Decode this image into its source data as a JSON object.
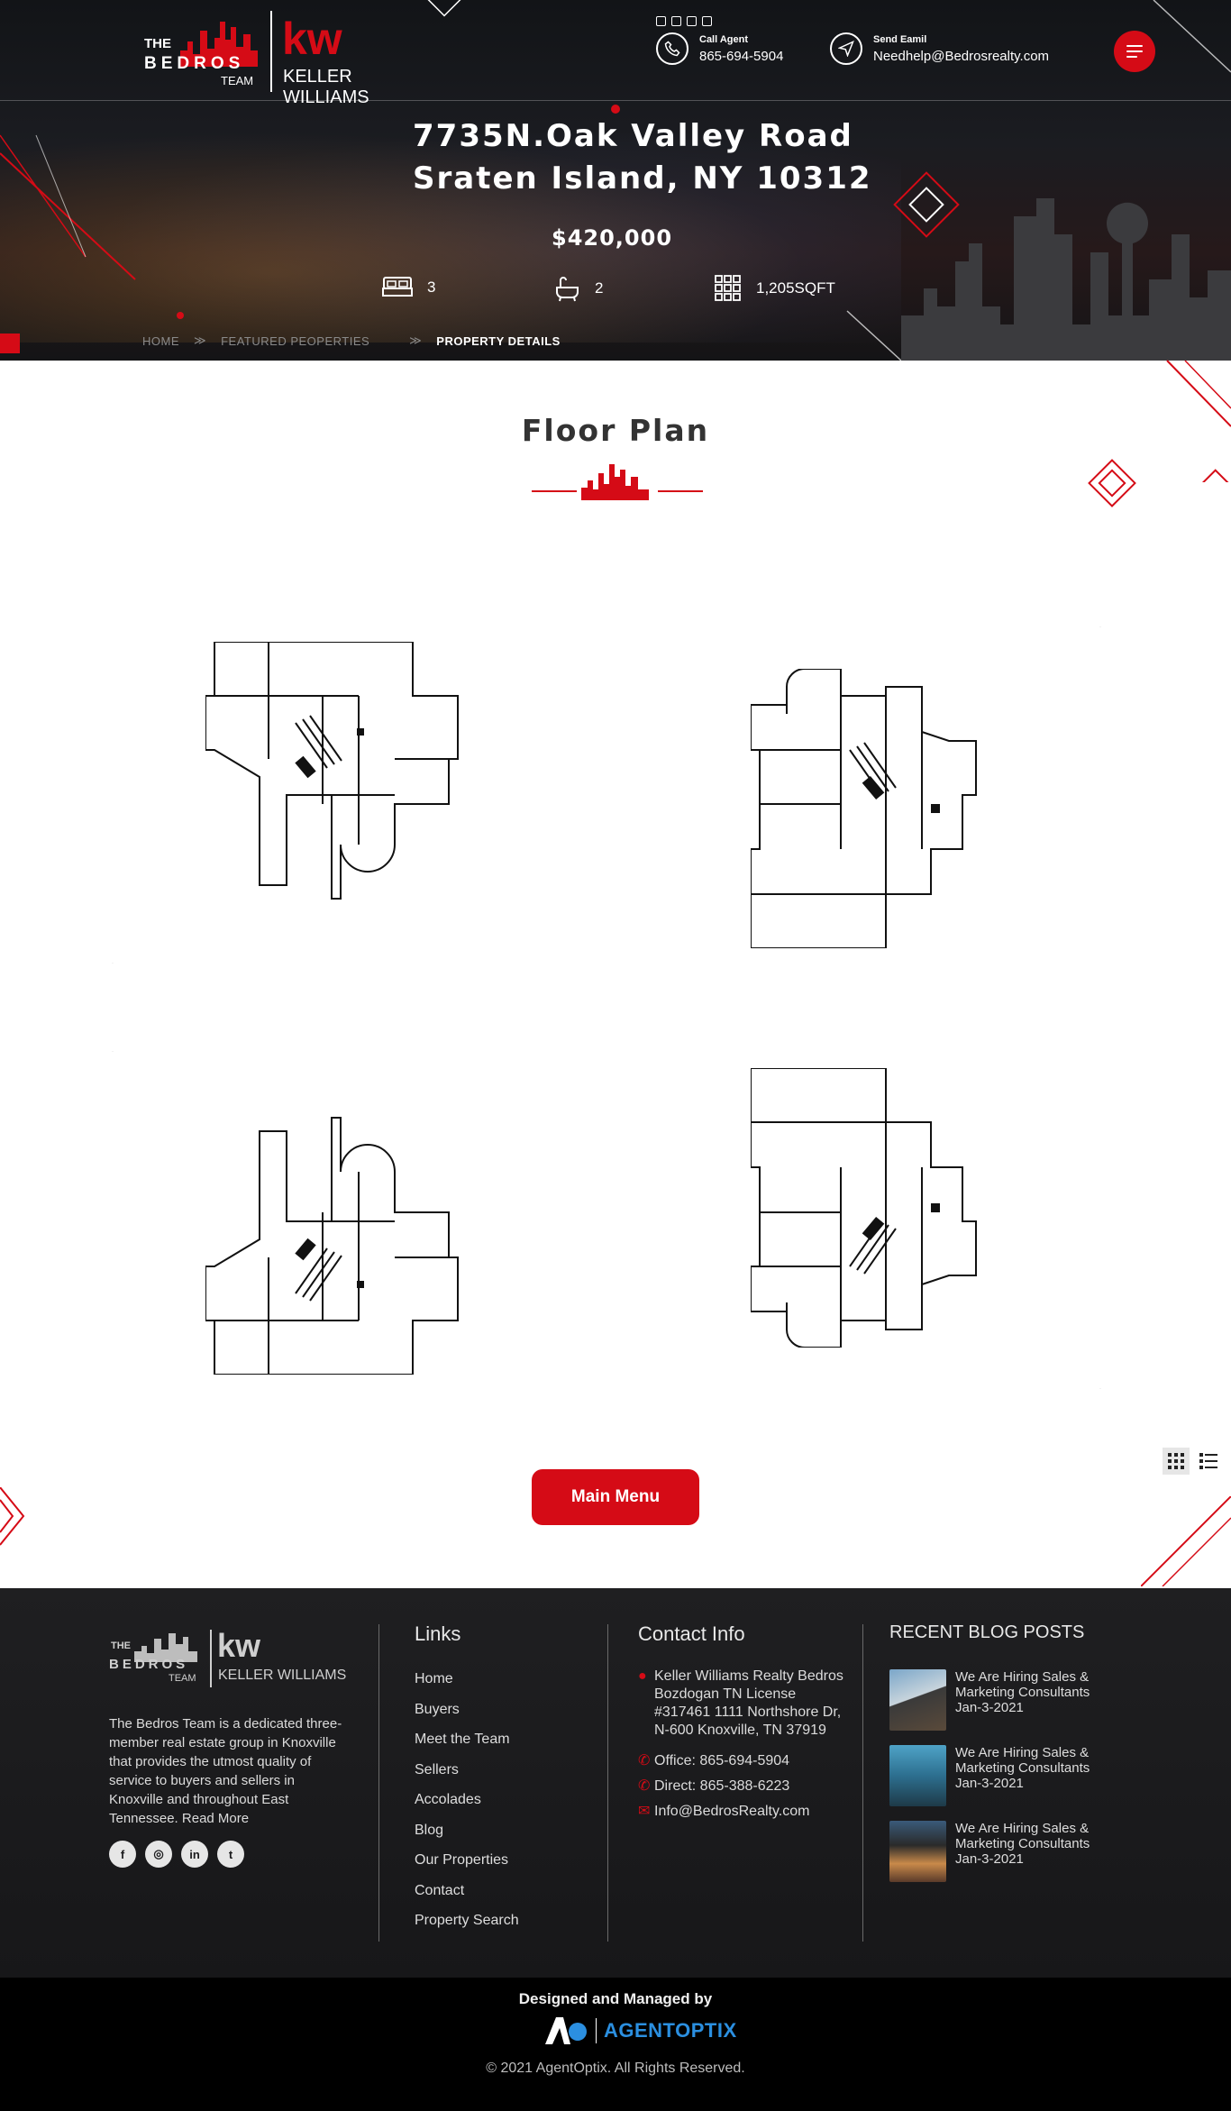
{
  "header": {
    "logo": {
      "the": "THE",
      "bedros": "BEDROS",
      "team": "TEAM",
      "kw": "kw",
      "keller": "KELLER WILLIAMS"
    },
    "call_label": "Call Agent",
    "call_value": "865-694-5904",
    "email_label": "Send Eamil",
    "email_value": "Needhelp@Bedrosrealty.com",
    "social_icons": [
      "facebook-icon",
      "twitter-icon",
      "youtube-icon",
      "instagram-icon"
    ]
  },
  "property": {
    "address_line1": "7735N.Oak Valley Road",
    "address_line2": "Sraten Island, NY 10312",
    "price": "$420,000",
    "beds": "3",
    "baths": "2",
    "area": "1,205SQFT"
  },
  "breadcrumb": {
    "home": "HOME",
    "featured": "FEATURED PEOPERTIES",
    "current": "PROPERTY DETAILS"
  },
  "floor_plan": {
    "title": "Floor Plan"
  },
  "main_menu_button": "Main Menu",
  "footer": {
    "about": "The Bedros Team is a dedicated three-member real estate group in Knoxville that provides the utmost quality of service to buyers and sellers in Knoxville and throughout East Tennessee. Read More",
    "links_heading": "Links",
    "links": [
      "Home",
      "Buyers",
      "Meet the Team",
      "Sellers",
      "Accolades",
      "Blog",
      "Our Properties",
      "Contact",
      "Property Search"
    ],
    "contact_heading": "Contact Info",
    "address": "Keller Williams Realty Bedros Bozdogan TN License #317461 1111 Northshore Dr, N-600 Knoxville, TN 37919",
    "office": "Office: 865-694-5904",
    "direct": "Direct: 865-388-6223",
    "email": "Info@BedrosRealty.com",
    "blog_heading": "RECENT BLOG POSTS",
    "blog_posts": [
      {
        "title": "We Are Hiring Sales & Marketing Consultants",
        "date": "Jan-3-2021"
      },
      {
        "title": "We Are Hiring Sales & Marketing Consultants",
        "date": "Jan-3-2021"
      },
      {
        "title": "We Are Hiring Sales & Marketing Consultants",
        "date": "Jan-3-2021"
      }
    ]
  },
  "bottom": {
    "designed_by": "Designed and Managed by",
    "brand": "AGENTOPTIX",
    "copyright": "© 2021 AgentOptix. All Rights Reserved."
  },
  "colors": {
    "accent_red": "#d50b16",
    "hero_dark": "#121417",
    "footer_bg": "#1b1b1d"
  }
}
